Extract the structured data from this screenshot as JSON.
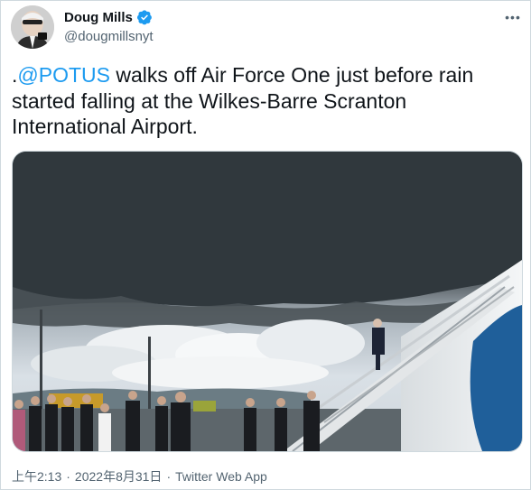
{
  "author": {
    "display_name": "Doug Mills",
    "handle": "@dougmillsnyt",
    "verified": true
  },
  "more_icon": "ellipsis-icon",
  "tweet": {
    "prefix": ".",
    "mention": "@POTUS",
    "text_after_mention": " walks off Air Force One just before rain started falling at the Wilkes-Barre Scranton International Airport."
  },
  "media": {
    "type": "photo"
  },
  "meta": {
    "time": "上午2:13",
    "separator": "·",
    "date": "2022年8月31日",
    "source": "Twitter Web App"
  },
  "colors": {
    "accent": "#1d9bf0",
    "text_primary": "#0f1419",
    "text_secondary": "#536471",
    "border": "#cfd9de"
  }
}
